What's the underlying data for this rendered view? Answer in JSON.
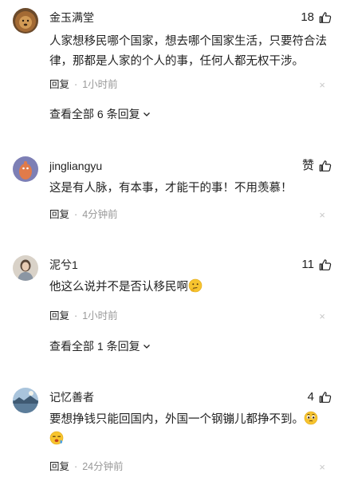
{
  "comments": [
    {
      "username": "金玉满堂",
      "avatar_icon": "lion-avatar-icon",
      "likes": "18",
      "content": "人家想移民哪个国家，想去哪个国家生活，只要符合法律，那都是人家的个人的事，任何人都无权干涉。",
      "reply_label": "回复",
      "separator": "·",
      "time": "1小时前",
      "close_glyph": "×",
      "view_all": "查看全部 6 条回复"
    },
    {
      "username": "jingliangyu",
      "avatar_icon": "cartoon-avatar-icon",
      "likes": "赞",
      "content": "这是有人脉，有本事，才能干的事！不用羡慕！",
      "reply_label": "回复",
      "separator": "·",
      "time": "4分钟前",
      "close_glyph": "×"
    },
    {
      "username": "泥兮1",
      "avatar_icon": "person-avatar-icon",
      "likes": "11",
      "content": "他这么说并不是否认移民啊",
      "emoji_icon": "thinking-emoji-icon",
      "reply_label": "回复",
      "separator": "·",
      "time": "1小时前",
      "close_glyph": "×",
      "view_all": "查看全部 1 条回复"
    },
    {
      "username": "记忆善者",
      "avatar_icon": "landscape-avatar-icon",
      "likes": "4",
      "content": "要想挣钱只能回国内，外国一个钢镚儿都挣不到。",
      "emoji_icons": [
        "pleading-emoji-icon",
        "fainting-emoji-icon"
      ],
      "reply_label": "回复",
      "separator": "·",
      "time": "24分钟前",
      "close_glyph": "×"
    }
  ],
  "colors": {
    "text": "#222222",
    "muted": "#999999",
    "close": "#c8c8c8"
  }
}
